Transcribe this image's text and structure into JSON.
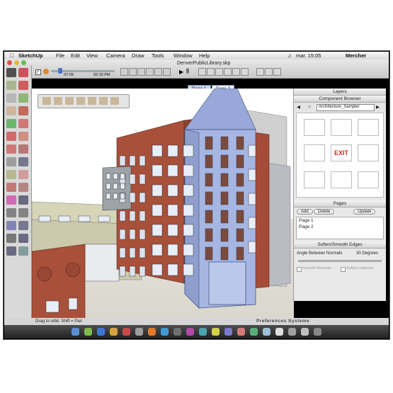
{
  "menubar": {
    "apple": "",
    "app_name": "SketchUp",
    "items": [
      "File",
      "Edit",
      "View",
      "Camera",
      "Draw",
      "Tools",
      "Window",
      "Help"
    ],
    "clock": "mar. 15:05",
    "user": "Mercher"
  },
  "window": {
    "title": "DenverPublicLibrary.skp"
  },
  "animation": {
    "time_start": "07:09",
    "time_end": "02:16 PM"
  },
  "scene_tabs": [
    {
      "label": "Page 1",
      "active": true
    },
    {
      "label": "Page 2",
      "active": false
    }
  ],
  "panels": {
    "layers_title": "Layers",
    "component_browser": {
      "title": "Component Browser",
      "collection": "Architecture_Sampler"
    },
    "component_items": [
      "door-icon",
      "door-panel-icon",
      "window-blinds-icon",
      "window-icon",
      "exit-sign-icon",
      "table-chairs-icon",
      "bed-icon",
      "shelf-icon",
      "sofa-icon"
    ],
    "exit_label": "EXIT",
    "pages": {
      "title": "Pages",
      "add_label": "Add",
      "delete_label": "Delete",
      "update_label": "Update",
      "list": [
        "Page 1",
        "Page 2"
      ]
    },
    "soften": {
      "title": "Soften/Smooth Edges",
      "angle_label": "Angle Between Normals",
      "angle_value": "30 Degrees",
      "smooth_normals": "Smooth Normals",
      "soften_coplanar": "Soften coplanar"
    }
  },
  "status": {
    "hint": "Drag to orbit.  Shift = Pan"
  },
  "watermark": "Preferences Systeme",
  "colors": {
    "brick": "#a8503a",
    "tower": "#a6b6e2",
    "window_frame": "#4a5b7a",
    "selection_blue": "#7f98d8",
    "menubar": "#e9e9e9",
    "dock": "#333333"
  }
}
